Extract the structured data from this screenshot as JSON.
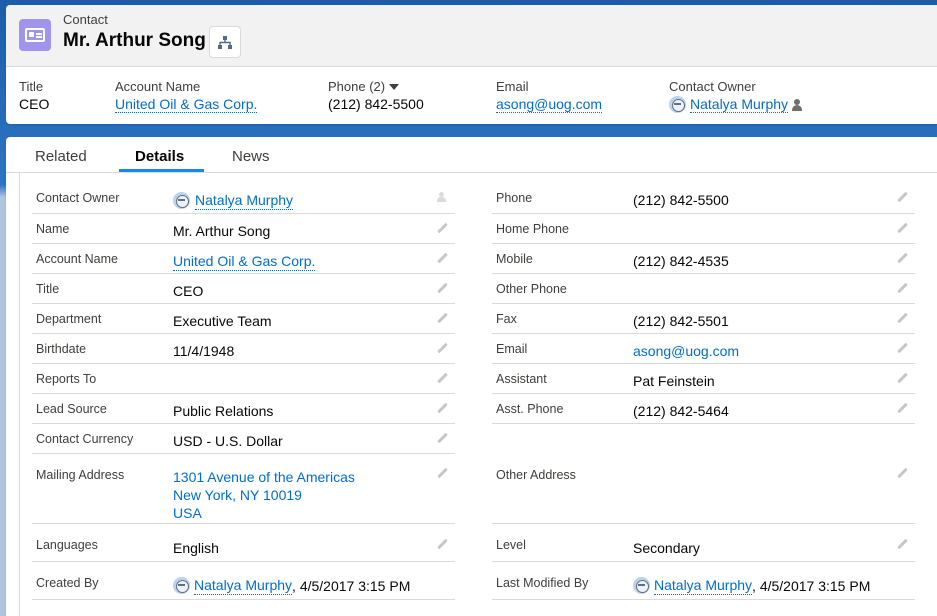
{
  "header": {
    "object_type": "Contact",
    "record_name": "Mr. Arthur Song",
    "highlights": [
      {
        "label": "Title",
        "value": "CEO"
      },
      {
        "label": "Account Name",
        "value": "United Oil & Gas Corp."
      },
      {
        "label": "Phone (2)",
        "value": "(212) 842-5500"
      },
      {
        "label": "Email",
        "value": "asong@uog.com"
      },
      {
        "label": "Contact Owner",
        "value": "Natalya Murphy"
      }
    ]
  },
  "tabs": [
    "Related",
    "Details",
    "News"
  ],
  "active_tab": "Details",
  "left_fields": [
    {
      "label": "Contact Owner",
      "value": "Natalya Murphy"
    },
    {
      "label": "Name",
      "value": "Mr. Arthur Song"
    },
    {
      "label": "Account Name",
      "value": "United Oil & Gas Corp."
    },
    {
      "label": "Title",
      "value": "CEO"
    },
    {
      "label": "Department",
      "value": "Executive Team"
    },
    {
      "label": "Birthdate",
      "value": "11/4/1948"
    },
    {
      "label": "Reports To",
      "value": ""
    },
    {
      "label": "Lead Source",
      "value": "Public Relations"
    },
    {
      "label": "Contact Currency",
      "value": "USD - U.S. Dollar"
    },
    {
      "label": "Mailing Address",
      "lines": [
        "1301 Avenue of the Americas",
        "New York, NY 10019",
        "USA"
      ]
    },
    {
      "label": "Languages",
      "value": "English"
    },
    {
      "label": "Created By",
      "value": "Natalya Murphy",
      "suffix": ", 4/5/2017 3:15 PM"
    }
  ],
  "right_fields": [
    {
      "label": "Phone",
      "value": "(212) 842-5500"
    },
    {
      "label": "Home Phone",
      "value": ""
    },
    {
      "label": "Mobile",
      "value": "(212) 842-4535"
    },
    {
      "label": "Other Phone",
      "value": ""
    },
    {
      "label": "Fax",
      "value": "(212) 842-5501"
    },
    {
      "label": "Email",
      "value": "asong@uog.com"
    },
    {
      "label": "Assistant",
      "value": "Pat Feinstein"
    },
    {
      "label": "Asst. Phone",
      "value": "(212) 842-5464"
    },
    {
      "label": "Other Address",
      "value": ""
    },
    {
      "label": "Level",
      "value": "Secondary"
    },
    {
      "label": "Last Modified By",
      "value": "Natalya Murphy",
      "suffix": ", 4/5/2017 3:15 PM"
    }
  ],
  "colors": {
    "accent": "#1589ee",
    "link": "#006dcc",
    "contact_icon": "#a094ed"
  }
}
